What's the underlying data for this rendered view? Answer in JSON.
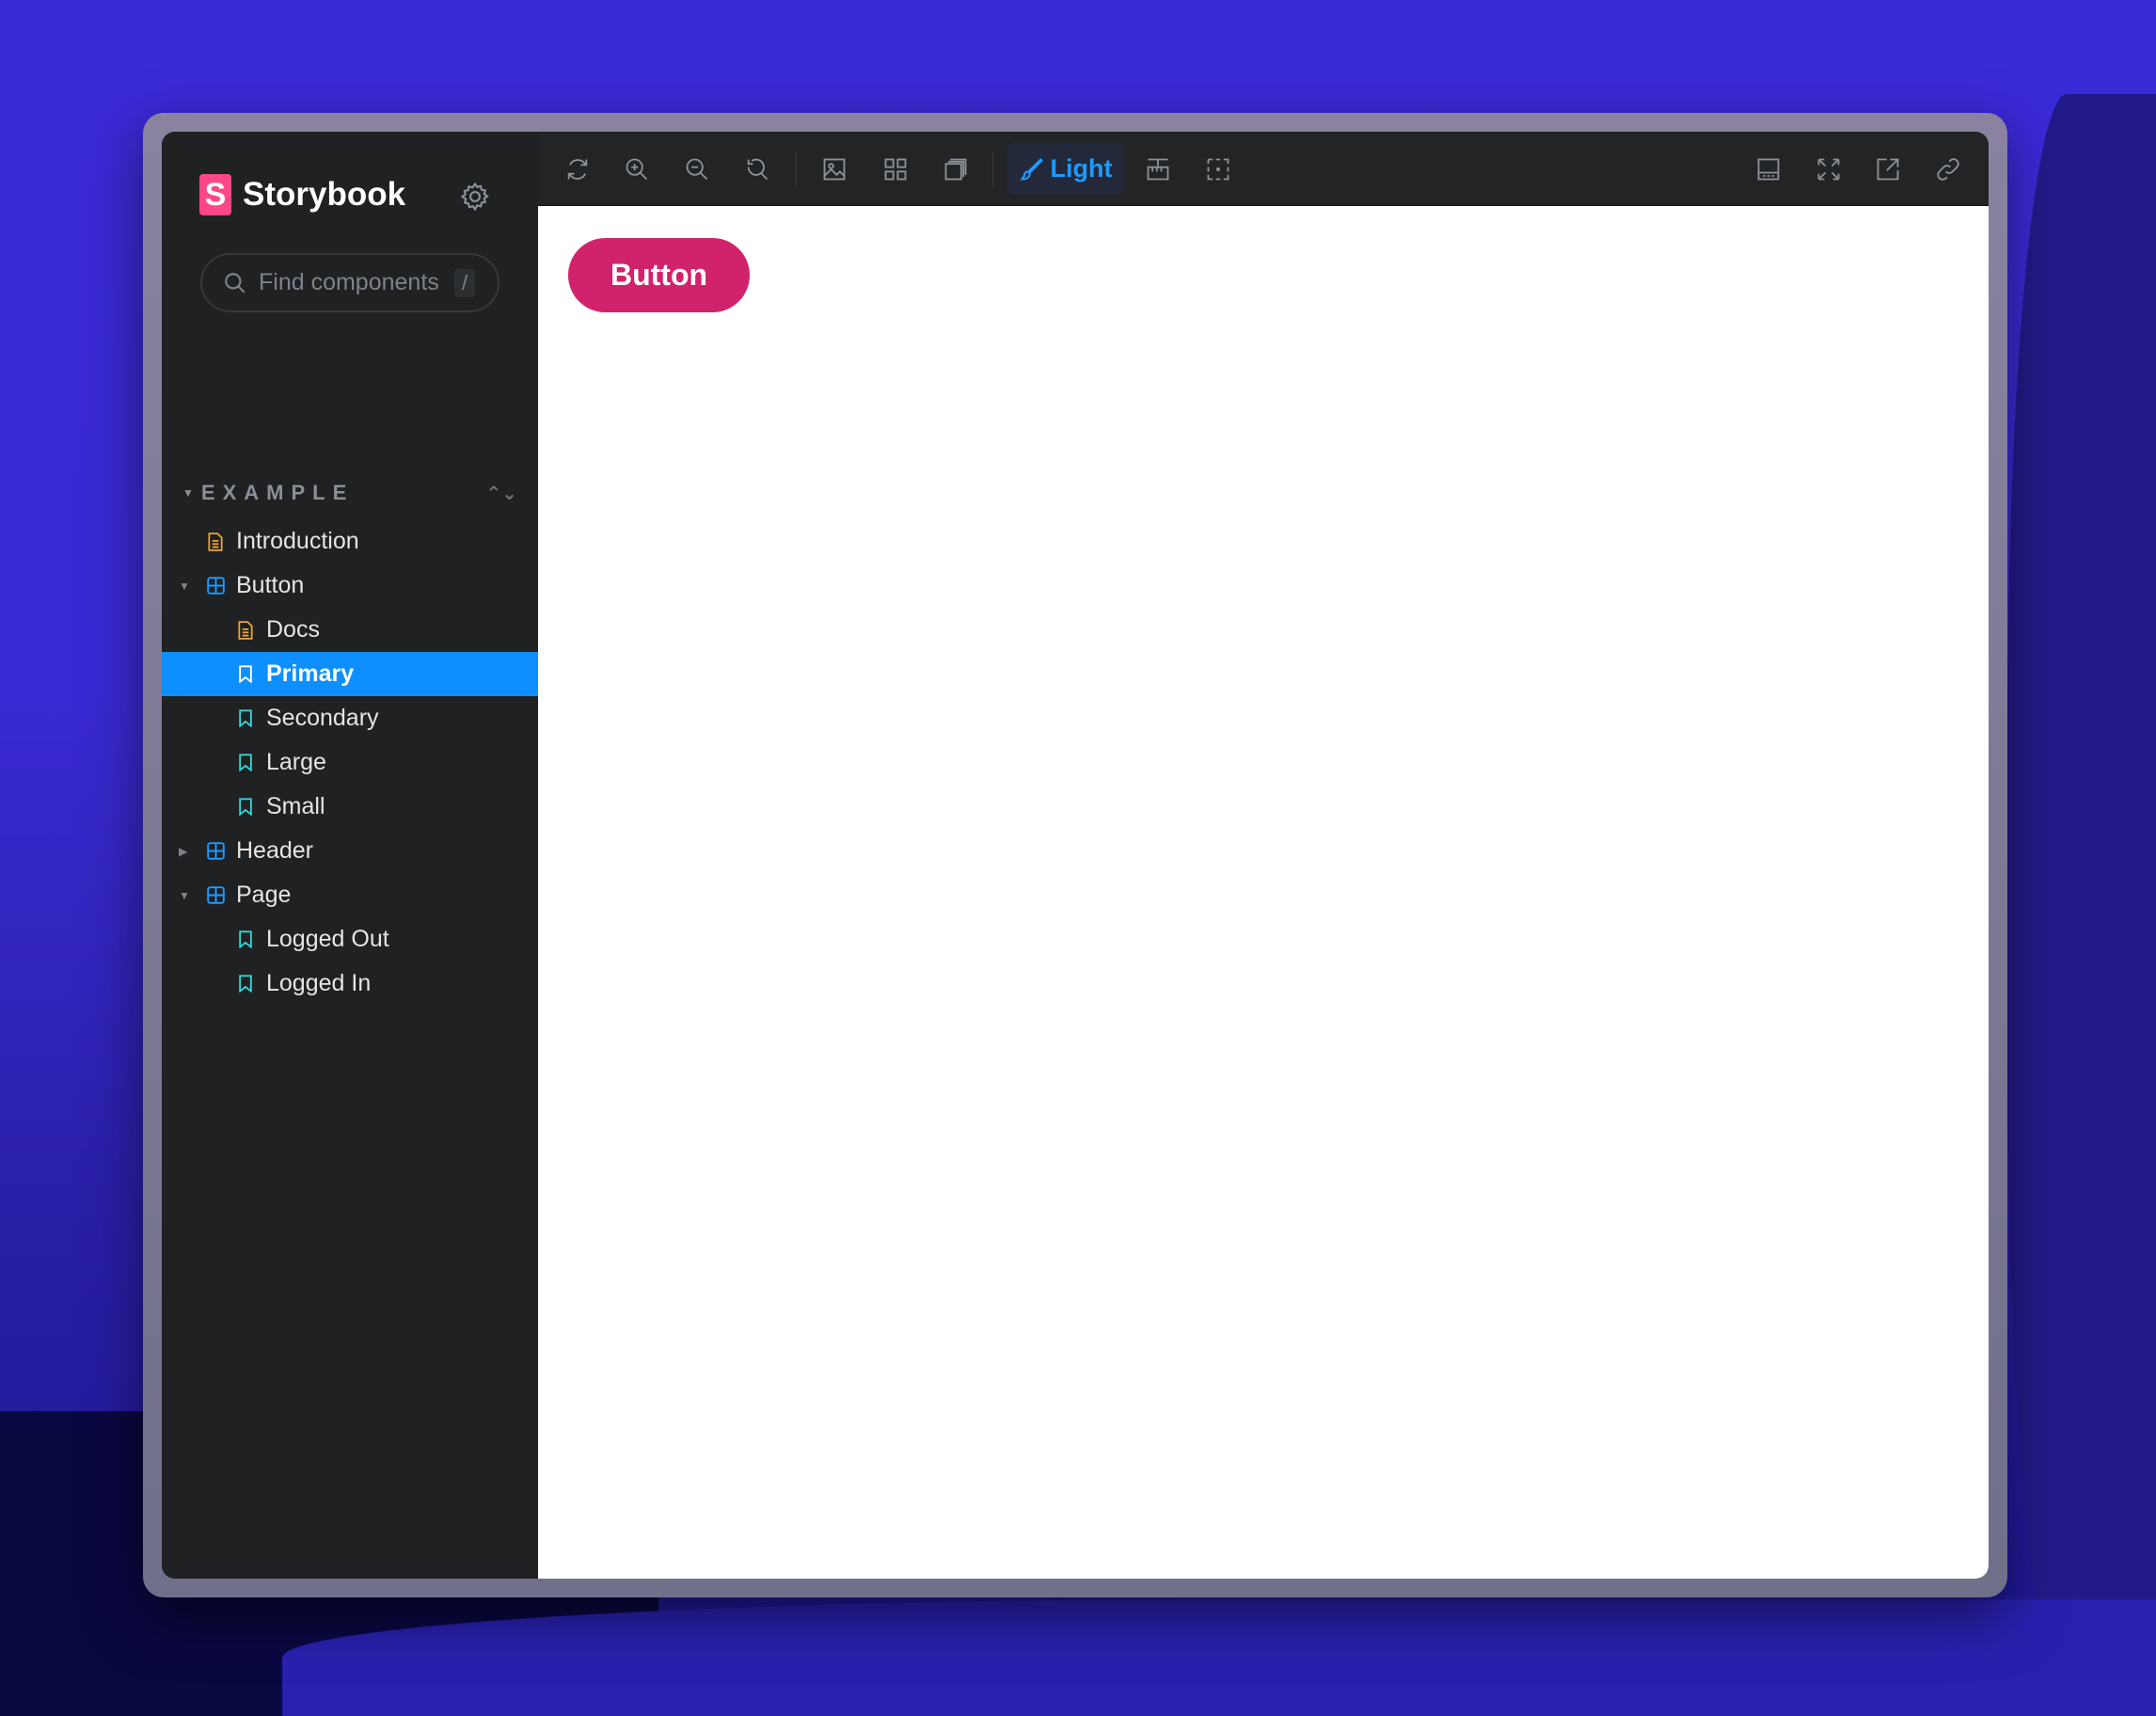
{
  "app": {
    "title": "Storybook",
    "accent": "#0d8fff",
    "brand": "#ff4785"
  },
  "search": {
    "placeholder": "Find components",
    "shortcut": "/"
  },
  "sidebar": {
    "group": "EXAMPLE",
    "items": [
      {
        "label": "Introduction",
        "icon": "document-icon",
        "level": 1
      },
      {
        "label": "Button",
        "icon": "component-icon",
        "level": 1,
        "expanded": true
      },
      {
        "label": "Docs",
        "icon": "document-icon",
        "level": 2
      },
      {
        "label": "Primary",
        "icon": "bookmark-icon",
        "level": 2,
        "selected": true
      },
      {
        "label": "Secondary",
        "icon": "bookmark-icon",
        "level": 2
      },
      {
        "label": "Large",
        "icon": "bookmark-icon",
        "level": 2
      },
      {
        "label": "Small",
        "icon": "bookmark-icon",
        "level": 2
      },
      {
        "label": "Header",
        "icon": "component-icon",
        "level": 1,
        "expanded": false
      },
      {
        "label": "Page",
        "icon": "component-icon",
        "level": 1,
        "expanded": true
      },
      {
        "label": "Logged Out",
        "icon": "bookmark-icon",
        "level": 2
      },
      {
        "label": "Logged In",
        "icon": "bookmark-icon",
        "level": 2
      }
    ]
  },
  "toolbar": {
    "theme_label": "Light",
    "tools": [
      "reload-icon",
      "zoom-in-icon",
      "zoom-out-icon",
      "zoom-reset-icon",
      "background-icon",
      "grid-icon",
      "outline-icon",
      "theme-brush-icon",
      "measure-icon",
      "viewport-icon"
    ],
    "right_tools": [
      "addons-panel-icon",
      "fullscreen-icon",
      "open-new-tab-icon",
      "copy-link-icon"
    ]
  },
  "preview": {
    "button_label": "Button",
    "button_color": "#d1236b"
  }
}
